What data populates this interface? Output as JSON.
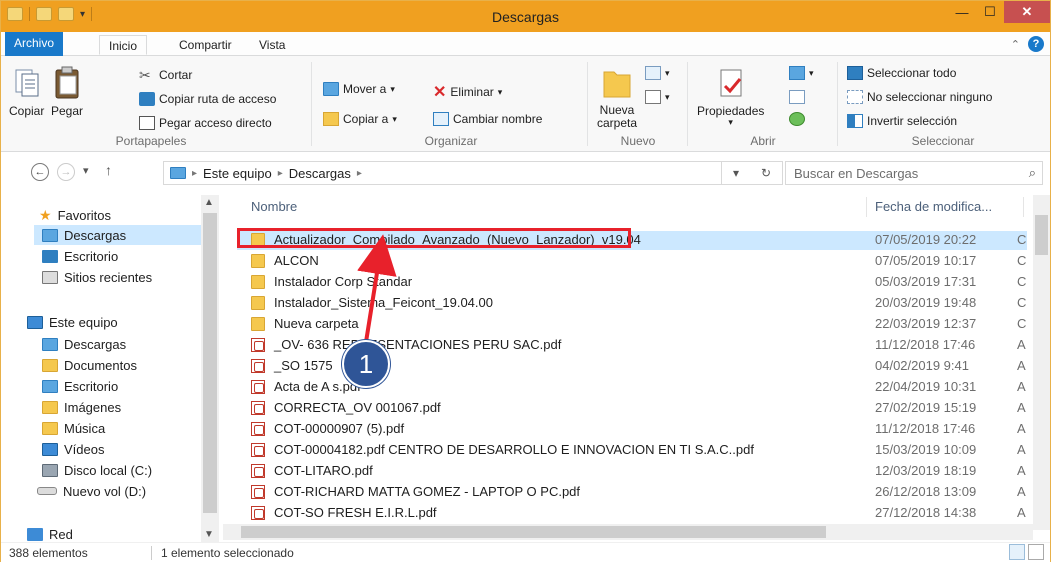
{
  "window": {
    "title": "Descargas",
    "controls": {
      "minimize": "—",
      "maximize": "☐",
      "close": "✕"
    }
  },
  "tabs": {
    "file": "Archivo",
    "home": "Inicio",
    "share": "Compartir",
    "view": "Vista"
  },
  "ribbon": {
    "portapapeles": {
      "label": "Portapapeles",
      "copy": "Copiar",
      "paste": "Pegar",
      "cut": "Cortar",
      "copy_path": "Copiar ruta de acceso",
      "paste_shortcut": "Pegar acceso directo"
    },
    "organizar": {
      "label": "Organizar",
      "move_to": "Mover a",
      "copy_to": "Copiar a",
      "delete": "Eliminar",
      "rename": "Cambiar nombre"
    },
    "nuevo": {
      "label": "Nuevo",
      "new_folder_line1": "Nueva",
      "new_folder_line2": "carpeta"
    },
    "abrir": {
      "label": "Abrir",
      "properties": "Propiedades"
    },
    "seleccionar": {
      "label": "Seleccionar",
      "select_all": "Seleccionar todo",
      "select_none": "No seleccionar ninguno",
      "invert": "Invertir selección"
    }
  },
  "address": {
    "crumbs": [
      "Este equipo",
      "Descargas"
    ],
    "search_placeholder": "Buscar en Descargas"
  },
  "navpane": {
    "favorites": "Favoritos",
    "fav_items": [
      "Descargas",
      "Escritorio",
      "Sitios recientes"
    ],
    "this_pc": "Este equipo",
    "pc_items": [
      "Descargas",
      "Documentos",
      "Escritorio",
      "Imágenes",
      "Música",
      "Vídeos",
      "Disco local (C:)",
      "Nuevo vol (D:)"
    ],
    "network": "Red"
  },
  "columns": {
    "name": "Nombre",
    "date": "Fecha de modifica..."
  },
  "files": [
    {
      "name": "Actualizador_Compilado_Avanzado_(Nuevo_Lanzador)_v19.04",
      "date": "07/05/2019 20:22",
      "type": "folder",
      "extra": "C"
    },
    {
      "name": "ALCON",
      "date": "07/05/2019 10:17",
      "type": "folder",
      "extra": "C"
    },
    {
      "name": "Instalador Corp Standar",
      "date": "05/03/2019 17:31",
      "type": "folder",
      "extra": "C"
    },
    {
      "name": "Instalador_Sistema_Feicont_19.04.00",
      "date": "20/03/2019 19:48",
      "type": "folder",
      "extra": "C"
    },
    {
      "name": "Nueva carpeta",
      "date": "22/03/2019 12:37",
      "type": "folder",
      "extra": "C"
    },
    {
      "name": "_OV- 636      REPRESENTACIONES PERU SAC.pdf",
      "date": "11/12/2018 17:46",
      "type": "pdf",
      "extra": "A"
    },
    {
      "name": "_SO 1575",
      "date": "04/02/2019 9:41",
      "type": "pdf",
      "extra": "A"
    },
    {
      "name": "Acta de A        s.pdf",
      "date": "22/04/2019 10:31",
      "type": "pdf",
      "extra": "A"
    },
    {
      "name": "CORRECTA_OV 001067.pdf",
      "date": "27/02/2019 15:19",
      "type": "pdf",
      "extra": "A"
    },
    {
      "name": "COT-00000907 (5).pdf",
      "date": "11/12/2018 17:46",
      "type": "pdf",
      "extra": "A"
    },
    {
      "name": "COT-00004182.pdf  CENTRO DE DESARROLLO E INNOVACION EN TI S.A.C..pdf",
      "date": "15/03/2019 10:09",
      "type": "pdf",
      "extra": "A"
    },
    {
      "name": "COT-LITARO.pdf",
      "date": "12/03/2019 18:19",
      "type": "pdf",
      "extra": "A"
    },
    {
      "name": "COT-RICHARD MATTA GOMEZ - LAPTOP O PC.pdf",
      "date": "26/12/2018 13:09",
      "type": "pdf",
      "extra": "A"
    },
    {
      "name": "COT-SO FRESH E.I.R.L.pdf",
      "date": "27/12/2018 14:38",
      "type": "pdf",
      "extra": "A"
    }
  ],
  "status": {
    "count": "388 elementos",
    "selection": "1 elemento seleccionado"
  },
  "annotation": {
    "callout_number": "1",
    "color": "#e8212b"
  }
}
